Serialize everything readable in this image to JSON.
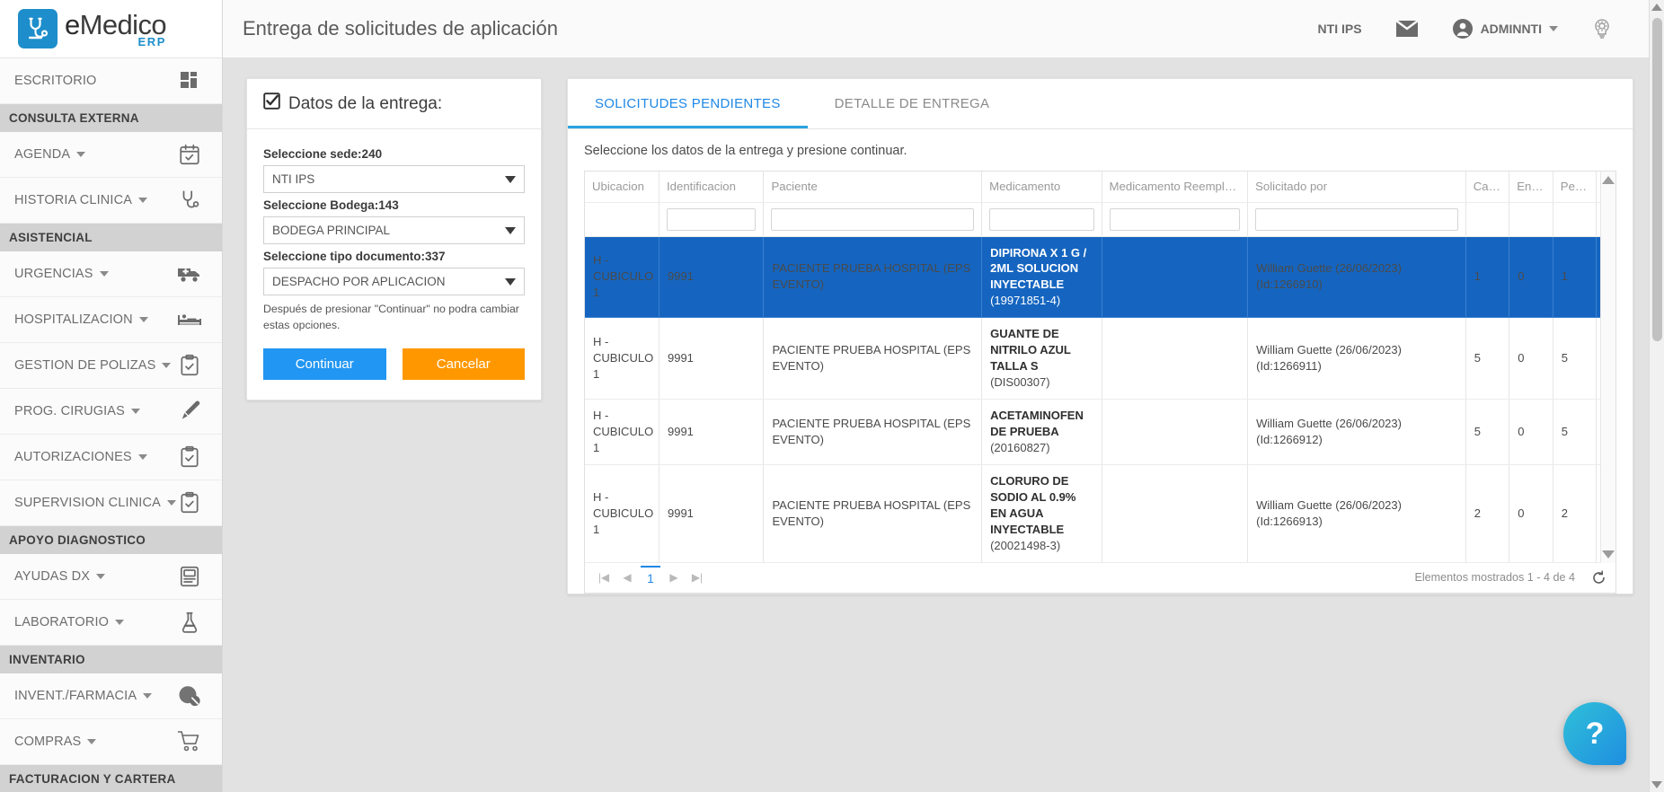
{
  "brand": {
    "name_e": "e",
    "name_rest": "Medico",
    "suffix": "ERP",
    "logo_icon": "stethoscope-icon"
  },
  "sidebar": {
    "desktop": {
      "label": "ESCRITORIO",
      "icon": "dashboard-grid-icon"
    },
    "groups": [
      {
        "title": "CONSULTA EXTERNA",
        "items": [
          {
            "label": "AGENDA",
            "icon": "calendar-check-icon"
          },
          {
            "label": "HISTORIA CLINICA",
            "icon": "stethoscope-icon"
          }
        ]
      },
      {
        "title": "ASISTENCIAL",
        "items": [
          {
            "label": "URGENCIAS",
            "icon": "ambulance-icon"
          },
          {
            "label": "HOSPITALIZACION",
            "icon": "hospital-bed-icon"
          },
          {
            "label": "GESTION DE POLIZAS",
            "icon": "clipboard-check-icon"
          },
          {
            "label": "PROG. CIRUGIAS",
            "icon": "scalpel-icon"
          },
          {
            "label": "AUTORIZACIONES",
            "icon": "clipboard-check-icon"
          },
          {
            "label": "SUPERVISION CLINICA",
            "icon": "clipboard-check-icon"
          }
        ]
      },
      {
        "title": "APOYO DIAGNOSTICO",
        "items": [
          {
            "label": "AYUDAS DX",
            "icon": "xray-document-icon"
          },
          {
            "label": "LABORATORIO",
            "icon": "flask-icon"
          }
        ]
      },
      {
        "title": "INVENTARIO",
        "items": [
          {
            "label": "INVENT./FARMACIA",
            "icon": "pills-icon"
          },
          {
            "label": "COMPRAS",
            "icon": "shopping-cart-icon"
          }
        ]
      },
      {
        "title": "FACTURACION Y CARTERA",
        "items": []
      }
    ]
  },
  "topbar": {
    "title": "Entrega de solicitudes de aplicación",
    "company": "NTI IPS",
    "mail_icon": "envelope-icon",
    "user": "ADMINNTI",
    "user_icon": "user-circle-icon",
    "settings_icon": "lightbulb-gear-icon"
  },
  "delivery_card": {
    "header": "Datos de la entrega:",
    "header_icon": "checkbox-checked-icon",
    "fields": [
      {
        "label": "Seleccione sede:240",
        "value": "NTI IPS"
      },
      {
        "label": "Seleccione Bodega:143",
        "value": "BODEGA PRINCIPAL"
      },
      {
        "label": "Seleccione tipo documento:337",
        "value": "DESPACHO POR APLICACION"
      }
    ],
    "hint": "Después de presionar \"Continuar\" no podra cambiar estas opciones.",
    "continue_label": "Continuar",
    "cancel_label": "Cancelar"
  },
  "panel": {
    "tabs": [
      {
        "label": "SOLICITUDES PENDIENTES",
        "active": true
      },
      {
        "label": "DETALLE DE ENTREGA",
        "active": false
      }
    ],
    "note": "Seleccione los datos de la entrega y presione continuar.",
    "columns": [
      "Ubicacion",
      "Identificacion",
      "Paciente",
      "Medicamento",
      "Medicamento Reemplazo",
      "Solicitado por",
      "Can...",
      "Entr...",
      "Pen..."
    ],
    "rows": [
      {
        "selected": true,
        "ubicacion": "H - CUBICULO 1",
        "identificacion": "9991",
        "paciente": "PACIENTE PRUEBA HOSPITAL (EPS EVENTO)",
        "medicamento_nombre": "DIPIRONA X 1 G / 2ML SOLUCION INYECTABLE",
        "medicamento_codigo": "(19971851-4)",
        "medicamento_reemplazo": "",
        "solicitado_por": "William Guette (26/06/2023) (Id:1266910)",
        "cantidad": "1",
        "entregado": "0",
        "pendiente": "1"
      },
      {
        "selected": false,
        "ubicacion": "H - CUBICULO 1",
        "identificacion": "9991",
        "paciente": "PACIENTE PRUEBA HOSPITAL (EPS EVENTO)",
        "medicamento_nombre": "GUANTE DE NITRILO AZUL TALLA S",
        "medicamento_codigo": "(DIS00307)",
        "medicamento_reemplazo": "",
        "solicitado_por": "William Guette (26/06/2023) (Id:1266911)",
        "cantidad": "5",
        "entregado": "0",
        "pendiente": "5"
      },
      {
        "selected": false,
        "ubicacion": "H - CUBICULO 1",
        "identificacion": "9991",
        "paciente": "PACIENTE PRUEBA HOSPITAL (EPS EVENTO)",
        "medicamento_nombre": "ACETAMINOFEN DE PRUEBA",
        "medicamento_codigo": "(20160827)",
        "medicamento_reemplazo": "",
        "solicitado_por": "William Guette (26/06/2023) (Id:1266912)",
        "cantidad": "5",
        "entregado": "0",
        "pendiente": "5"
      },
      {
        "selected": false,
        "ubicacion": "H - CUBICULO 1",
        "identificacion": "9991",
        "paciente": "PACIENTE PRUEBA HOSPITAL (EPS EVENTO)",
        "medicamento_nombre": "CLORURO DE SODIO AL 0.9% EN AGUA INYECTABLE",
        "medicamento_codigo": "(20021498-3)",
        "medicamento_reemplazo": "",
        "solicitado_por": "William Guette (26/06/2023) (Id:1266913)",
        "cantidad": "2",
        "entregado": "0",
        "pendiente": "2"
      }
    ],
    "pager": {
      "first": "|◀",
      "prev": "◀",
      "page": "1",
      "next": "▶",
      "last": "▶|",
      "info": "Elementos mostrados 1 - 4 de 4",
      "refresh_icon": "refresh-icon"
    }
  },
  "help": {
    "label": "?",
    "icon": "help-icon"
  },
  "colors": {
    "accent": "#1e88e5",
    "selected_row": "#1565c0",
    "primary_button": "#2196f3",
    "warn_button": "#ff9800",
    "brand_blue": "#1d8ecb"
  }
}
